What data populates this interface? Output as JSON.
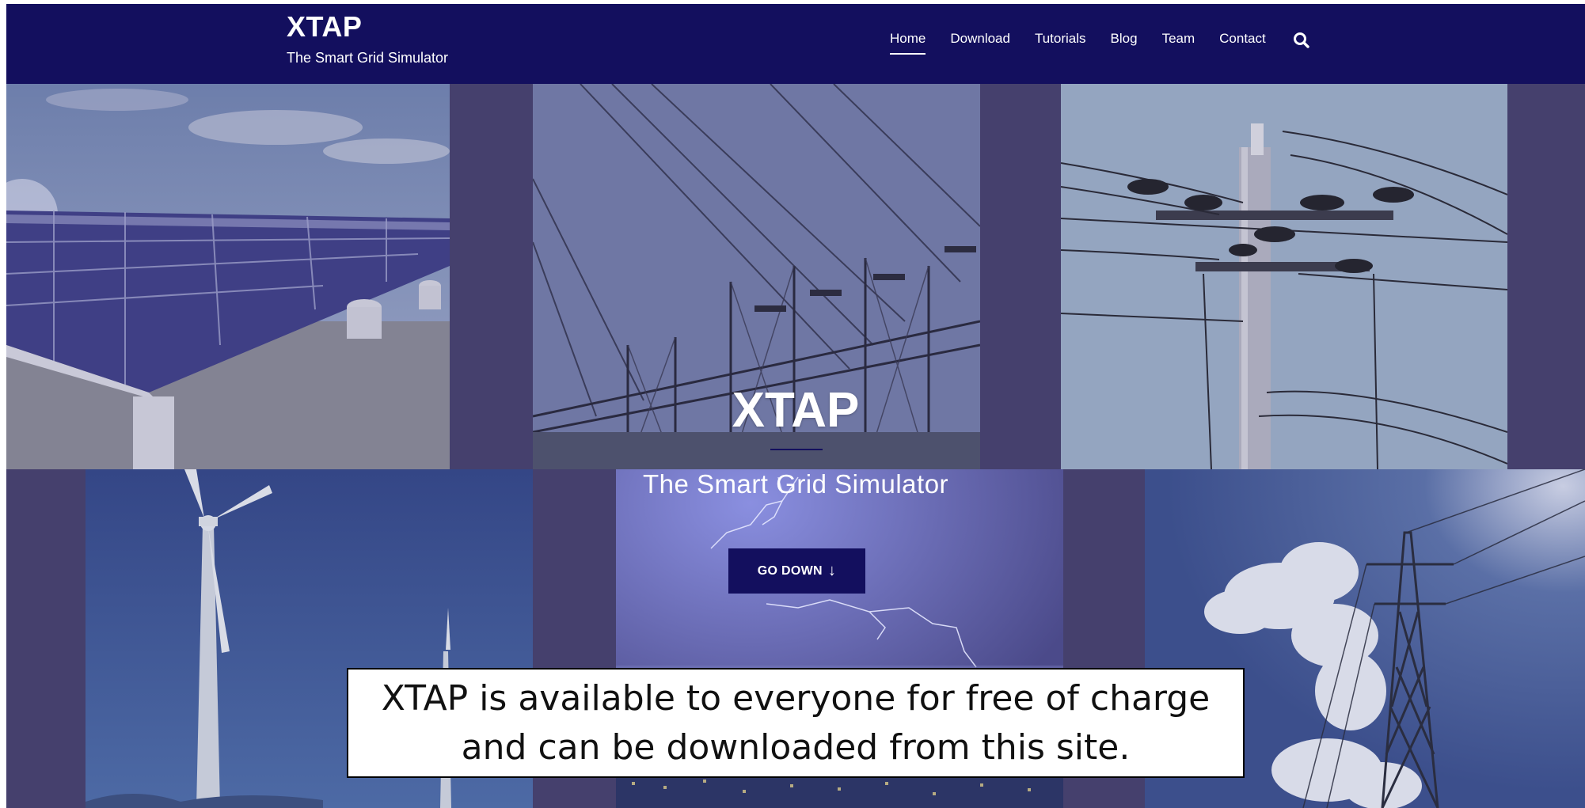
{
  "site": {
    "title": "XTAP",
    "tagline": "The Smart Grid Simulator"
  },
  "nav": {
    "items": [
      "Home",
      "Download",
      "Tutorials",
      "Blog",
      "Team",
      "Contact"
    ],
    "active": "Home",
    "search_icon": "search-icon"
  },
  "hero": {
    "title": "XTAP",
    "subtitle": "The Smart Grid Simulator",
    "button_label": "GO DOWN",
    "button_arrow": "↓"
  },
  "tiles": [
    "solar-panels-image",
    "substation-image",
    "utility-pole-image",
    "wind-turbines-image",
    "lightning-city-image",
    "transmission-tower-image"
  ],
  "notice": {
    "line1": "XTAP is available to everyone for free of charge",
    "line2": "and can be downloaded from this site."
  },
  "colors": {
    "header_bg": "#130f5e",
    "overlay": "#45406d",
    "button_bg": "#130f5e"
  }
}
